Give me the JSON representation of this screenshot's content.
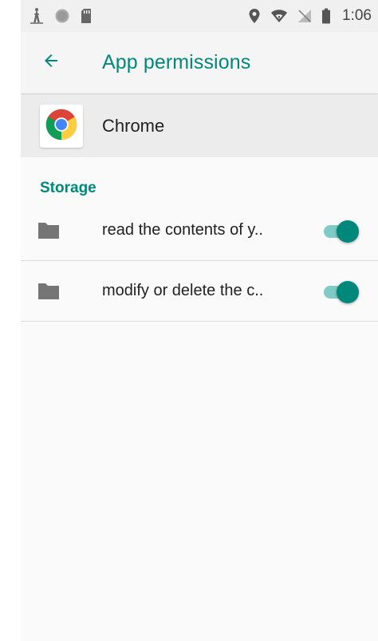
{
  "status_bar": {
    "time": "1:06",
    "left_icons": [
      "radio-tower-icon",
      "circle-notification-icon",
      "sd-card-icon"
    ],
    "right_icons": [
      "location-pin-icon",
      "wifi-icon",
      "no-sim-icon",
      "battery-icon"
    ]
  },
  "app_bar": {
    "title": "App permissions",
    "back_icon": "arrow-back-icon"
  },
  "app": {
    "name": "Chrome",
    "icon": "chrome-logo-icon"
  },
  "section": {
    "title": "Storage"
  },
  "permissions": [
    {
      "label": "read the contents of y..",
      "icon": "folder-icon",
      "enabled": true
    },
    {
      "label": "modify or delete the c..",
      "icon": "folder-icon",
      "enabled": true
    }
  ],
  "colors": {
    "accent": "#00897b",
    "accent_light": "#80cbc4",
    "background": "#fafafa",
    "status_bar": "#f0f0f0"
  }
}
